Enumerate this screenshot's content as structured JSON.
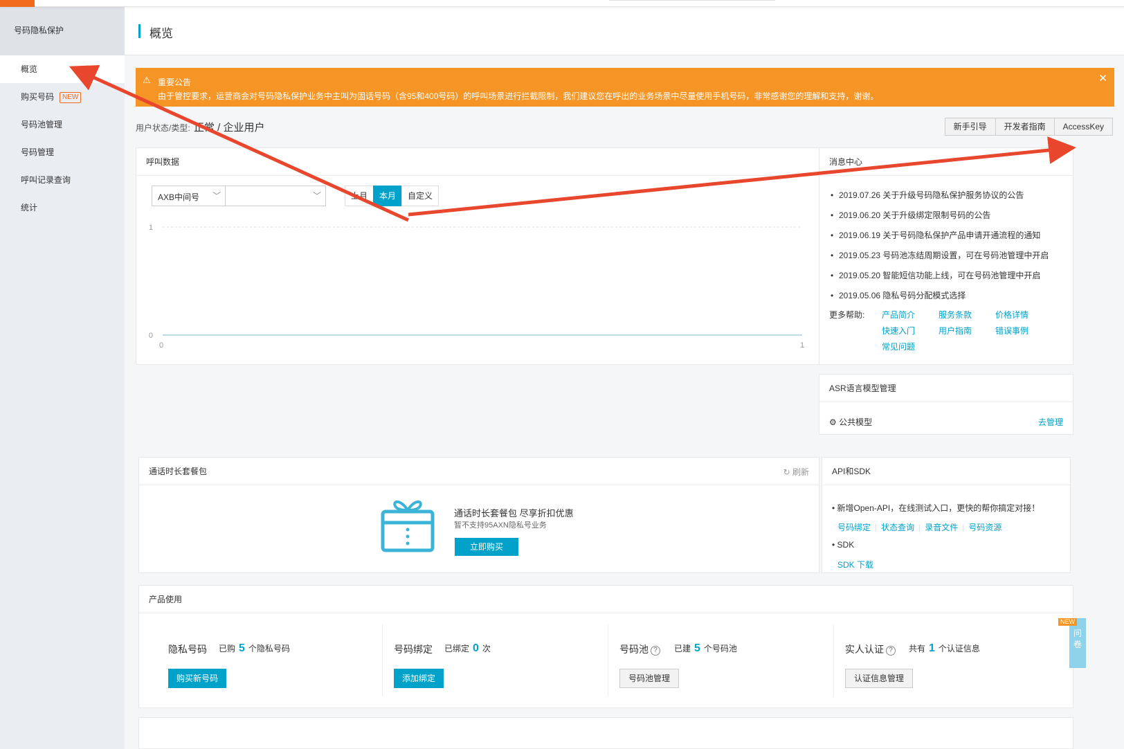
{
  "sidebar": {
    "product_title": "号码隐私保护",
    "items": [
      {
        "label": "概览"
      },
      {
        "label": "购买号码",
        "badge": "NEW"
      },
      {
        "label": "号码池管理"
      },
      {
        "label": "号码管理"
      },
      {
        "label": "呼叫记录查询"
      },
      {
        "label": "统计"
      }
    ]
  },
  "header": {
    "title": "概览"
  },
  "notice": {
    "title": "重要公告",
    "text": "由于管控要求，运营商会对号码隐私保护业务中主叫为固话号码（含95和400号码）的呼叫场景进行拦截限制，我们建议您在呼出的业务场景中尽量使用手机号码，非常感谢您的理解和支持，谢谢。",
    "close": "✕"
  },
  "user_status": {
    "label": "用户状态/类型:",
    "value": "正常 / 企业用户"
  },
  "top_buttons": [
    "新手引导",
    "开发者指南",
    "AccessKey"
  ],
  "call_data": {
    "title": "呼叫数据",
    "select1": "AXB中间号",
    "select2": "",
    "periods": [
      "上月",
      "本月",
      "自定义"
    ],
    "active_period": "本月"
  },
  "chart_data": {
    "type": "line",
    "x": [
      0,
      1
    ],
    "series": [
      {
        "values": [
          0,
          0
        ]
      }
    ],
    "xlim": [
      0,
      1
    ],
    "ylim": [
      0,
      1
    ],
    "xticks": [
      "0",
      "1"
    ],
    "yticks": [
      "0",
      "1"
    ],
    "grid": true
  },
  "message_center": {
    "title": "消息中心",
    "items": [
      "2019.07.26 关于升级号码隐私保护服务协议的公告",
      "2019.06.20 关于升级绑定限制号码的公告",
      "2019.06.19 关于号码隐私保护产品申请开通流程的通知",
      "2019.05.23 号码池冻结周期设置，可在号码池管理中开启",
      "2019.05.20 智能短信功能上线，可在号码池管理中开启",
      "2019.05.06 隐私号码分配模式选择"
    ],
    "more_help_label": "更多帮助:",
    "help_links": [
      "产品简介",
      "服务条款",
      "价格详情",
      "快速入门",
      "用户指南",
      "错误事例",
      "常见问题"
    ]
  },
  "asr": {
    "title": "ASR语言模型管理",
    "public_model": "公共模型",
    "manage": "去管理"
  },
  "package": {
    "title": "通话时长套餐包",
    "refresh": "刷新",
    "promo_title": "通话时长套餐包 尽享折扣优惠",
    "promo_sub": "暂不支持95AXN隐私号业务",
    "buy_button": "立即购买"
  },
  "api_sdk": {
    "title": "API和SDK",
    "line1": "• 新增Open-API，在线测试入口，更快的帮你搞定对接！",
    "links": [
      "号码绑定",
      "状态查询",
      "录音文件",
      "号码资源"
    ],
    "sdk_label": "• SDK",
    "sdk_download": "SDK 下载"
  },
  "usage": {
    "title": "产品使用",
    "cols": [
      {
        "label": "隐私号码",
        "pre": "已购",
        "num": "5",
        "post": "个隐私号码",
        "button": "购买新号码"
      },
      {
        "label": "号码绑定",
        "pre": "已绑定",
        "num": "0",
        "post": "次",
        "button": "添加绑定"
      },
      {
        "label": "号码池",
        "pre": "已建",
        "num": "5",
        "post": "个号码池",
        "button": "号码池管理"
      },
      {
        "label": "实人认证",
        "pre": "共有",
        "num": "1",
        "post": "个认证信息",
        "button": "认证信息管理"
      }
    ]
  },
  "survey": {
    "badge": "NEW",
    "text": "问卷"
  },
  "colors": {
    "accent": "#00a2ca",
    "notice": "#f49525",
    "annotation_arrow": "#e8472e"
  }
}
